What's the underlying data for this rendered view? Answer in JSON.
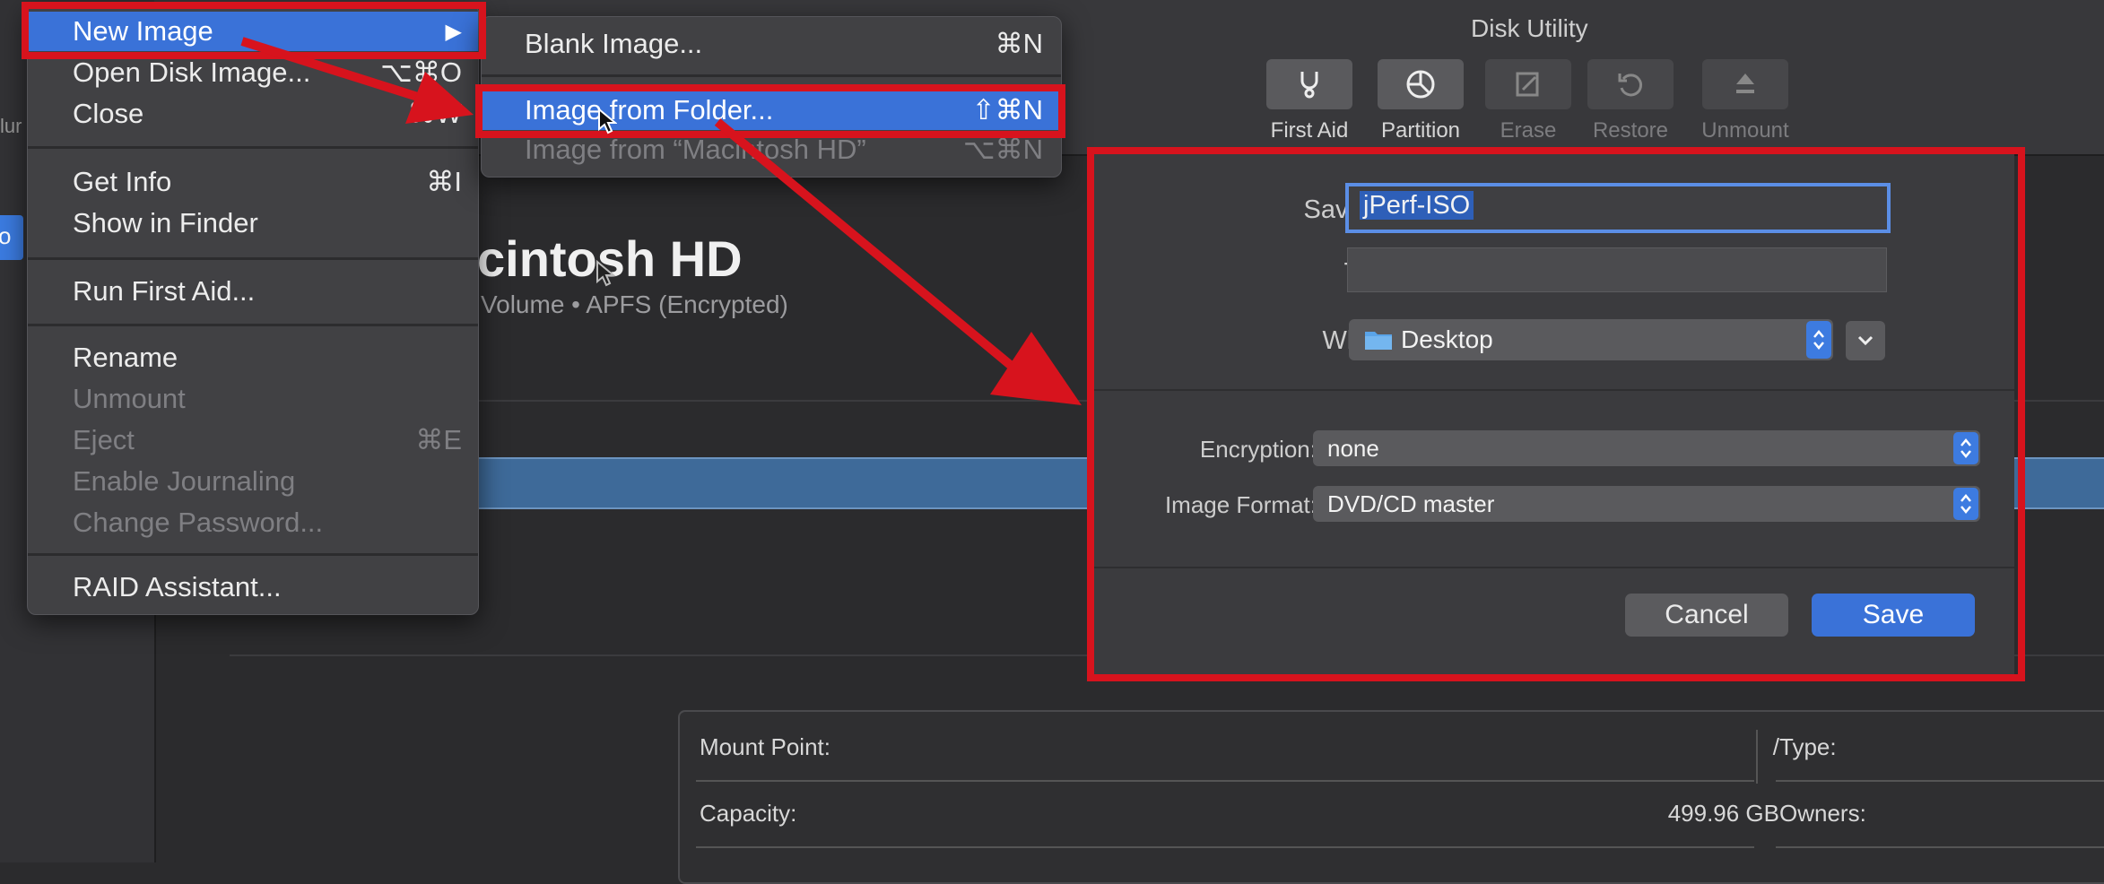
{
  "window": {
    "title": "Disk Utility"
  },
  "sidebar": {
    "volume_label_fragment": "lur",
    "selected_fragment": "o"
  },
  "toolbar": {
    "buttons": [
      {
        "label": "First Aid",
        "icon": "stethoscope-icon",
        "enabled": true
      },
      {
        "label": "Partition",
        "icon": "pie-chart-icon",
        "enabled": true
      },
      {
        "label": "Erase",
        "icon": "erase-icon",
        "enabled": false
      },
      {
        "label": "Restore",
        "icon": "restore-icon",
        "enabled": false
      },
      {
        "label": "Unmount",
        "icon": "eject-icon",
        "enabled": false
      }
    ]
  },
  "volume": {
    "name": "cintosh HD",
    "subtitle": "Volume • APFS (Encrypted)"
  },
  "info": {
    "mount_point_label": "Mount Point:",
    "mount_point_value": "/",
    "capacity_label": "Capacity:",
    "capacity_value": "499.96 GB",
    "type_label": "Type:",
    "owners_label": "Owners:"
  },
  "file_menu": {
    "items": [
      {
        "label": "New Image",
        "shortcut": "▶",
        "highlighted": true
      },
      {
        "label": "Open Disk Image...",
        "shortcut": "⌥⌘O"
      },
      {
        "label": "Close",
        "shortcut": "⌘W"
      },
      {
        "label": "Get Info",
        "shortcut": "⌘I"
      },
      {
        "label": "Show in Finder",
        "shortcut": ""
      },
      {
        "label": "Run First Aid...",
        "shortcut": ""
      },
      {
        "label": "Rename",
        "shortcut": ""
      },
      {
        "label": "Unmount",
        "shortcut": "",
        "disabled": true
      },
      {
        "label": "Eject",
        "shortcut": "⌘E",
        "disabled": true
      },
      {
        "label": "Enable Journaling",
        "shortcut": "",
        "disabled": true
      },
      {
        "label": "Change Password...",
        "shortcut": "",
        "disabled": true
      },
      {
        "label": "RAID Assistant...",
        "shortcut": ""
      }
    ]
  },
  "new_image_submenu": {
    "items": [
      {
        "label": "Blank Image...",
        "shortcut": "⌘N"
      },
      {
        "label": "Image from Folder...",
        "shortcut": "⇧⌘N",
        "highlighted": true
      },
      {
        "label": "Image from “Macintosh HD”",
        "shortcut": "⌥⌘N",
        "disabled": true
      }
    ]
  },
  "save_dialog": {
    "save_as_label": "Save As:",
    "save_as_value": "jPerf-ISO",
    "tags_label": "Tags:",
    "tags_value": "",
    "where_label": "Where:",
    "where_value": "Desktop",
    "encryption_label": "Encryption:",
    "encryption_value": "none",
    "format_label": "Image Format:",
    "format_value": "DVD/CD master",
    "cancel_label": "Cancel",
    "save_label": "Save"
  },
  "colors": {
    "annotation_red": "#d7131d",
    "accent_blue": "#3a72d8"
  }
}
